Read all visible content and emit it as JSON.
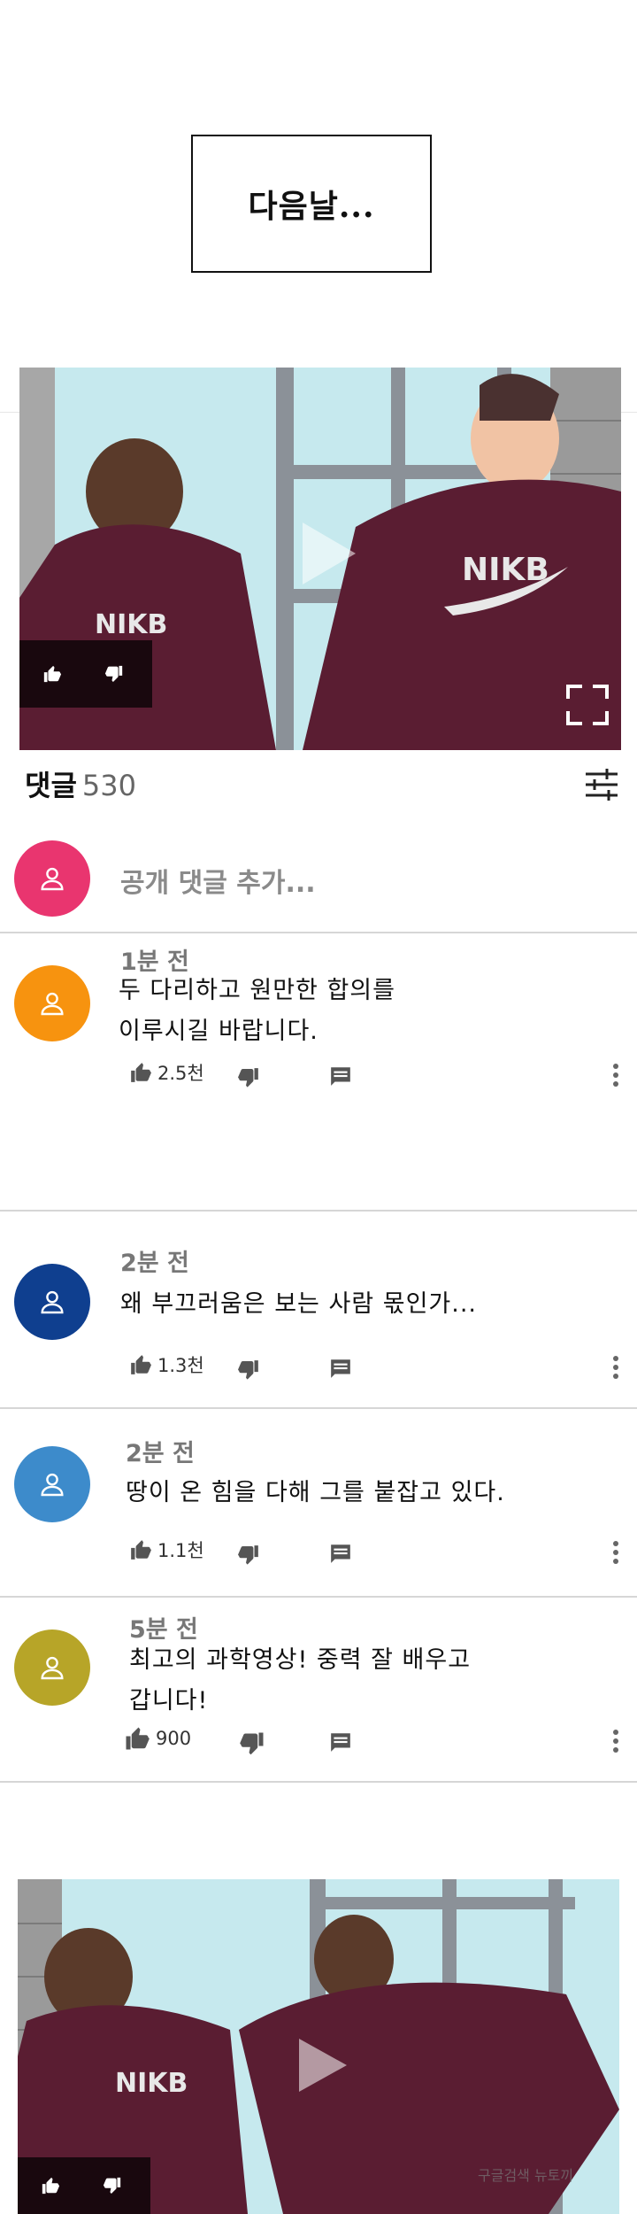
{
  "caption": "다음날...",
  "comments_header": {
    "label": "댓글",
    "count": "530"
  },
  "add_comment_placeholder": "공개 댓글 추가...",
  "colors": {
    "avatar_top": "#e9356f",
    "accent": "#111111"
  },
  "comments": [
    {
      "time": "1분 전",
      "lines": [
        "두 다리하고 원만한 합의를",
        "이루시길 바랍니다."
      ],
      "likes": "2.5천",
      "avatar_color": "#f7930f"
    },
    {
      "time": "2분 전",
      "lines": [
        "왜 부끄러움은 보는 사람 몫인가..."
      ],
      "likes": "1.3천",
      "avatar_color": "#0f3f8f"
    },
    {
      "time": "2분 전",
      "lines": [
        "땅이 온 힘을 다해 그를 붙잡고 있다."
      ],
      "likes": "1.1천",
      "avatar_color": "#3d8bcb"
    },
    {
      "time": "5분 전",
      "lines": [
        "최고의 과학영상! 중력 잘 배우고",
        "갑니다!"
      ],
      "likes": "900",
      "avatar_color": "#b7a528"
    }
  ],
  "watermark": "구글검색 뉴토끼",
  "icons": [
    "thumbs-up-icon",
    "thumbs-down-icon",
    "reply-icon",
    "more-vert-icon",
    "fullscreen-icon",
    "play-icon",
    "person-icon",
    "filter-icon"
  ]
}
